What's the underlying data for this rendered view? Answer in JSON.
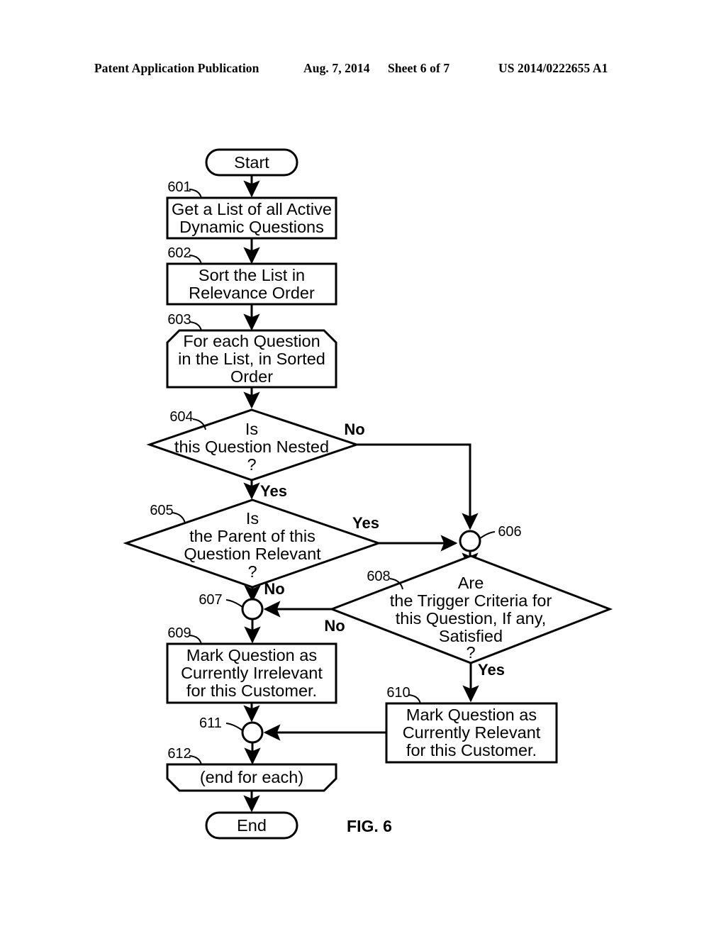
{
  "header": {
    "publication": "Patent Application Publication",
    "date": "Aug. 7, 2014",
    "sheet": "Sheet 6 of 7",
    "number": "US 2014/0222655 A1"
  },
  "figure": {
    "label": "FIG. 6",
    "start_label": "Start",
    "end_label": "End"
  },
  "nodes": {
    "n601": {
      "ref": "601",
      "line1": "Get a List of all Active",
      "line2": "Dynamic Questions"
    },
    "n602": {
      "ref": "602",
      "line1": "Sort the List in",
      "line2": "Relevance Order"
    },
    "n603": {
      "ref": "603",
      "line1": "For each Question",
      "line2": "in the List, in Sorted",
      "line3": "Order"
    },
    "n604": {
      "ref": "604",
      "line1": "Is",
      "line2": "this Question Nested",
      "line3": "?"
    },
    "n605": {
      "ref": "605",
      "line1": "Is",
      "line2": "the Parent of this",
      "line3": "Question Relevant",
      "line4": "?"
    },
    "n606": {
      "ref": "606"
    },
    "n607": {
      "ref": "607"
    },
    "n608": {
      "ref": "608",
      "line1": "Are",
      "line2": "the Trigger Criteria for",
      "line3": "this Question, If any,",
      "line4": "Satisfied",
      "line5": "?"
    },
    "n609": {
      "ref": "609",
      "line1": "Mark Question as",
      "line2": "Currently Irrelevant",
      "line3": "for this Customer."
    },
    "n610": {
      "ref": "610",
      "line1": "Mark Question as",
      "line2": "Currently Relevant",
      "line3": "for this Customer."
    },
    "n611": {
      "ref": "611"
    },
    "n612": {
      "ref": "612",
      "line1": "(end for each)"
    }
  },
  "branches": {
    "b604_no": "No",
    "b604_yes": "Yes",
    "b605_yes": "Yes",
    "b605_no": "No",
    "b608_no": "No",
    "b608_yes": "Yes"
  },
  "colors": {
    "ink": "#000000",
    "paper": "#ffffff"
  }
}
